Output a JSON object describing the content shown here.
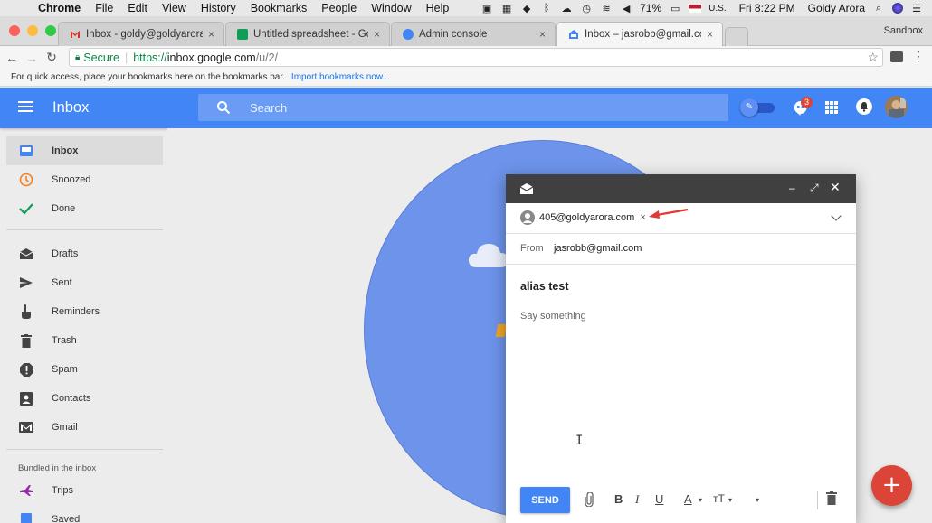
{
  "menubar": {
    "app": "Chrome",
    "menus": [
      "File",
      "Edit",
      "View",
      "History",
      "Bookmarks",
      "People",
      "Window",
      "Help"
    ],
    "battery": "71%",
    "input_source": "U.S.",
    "clock": "Fri 8:22 PM",
    "user": "Goldy Arora"
  },
  "tabs": [
    {
      "title": "Inbox - goldy@goldyarora.com",
      "favicon": "gmail-icon",
      "color": "#d93025"
    },
    {
      "title": "Untitled spreadsheet - Google",
      "favicon": "sheets-icon",
      "color": "#0f9d58"
    },
    {
      "title": "Admin console",
      "favicon": "admin-icon",
      "color": "#4285f4"
    },
    {
      "title": "Inbox – jasrobb@gmail.com",
      "favicon": "inbox-icon",
      "color": "#4285f4"
    }
  ],
  "window_profile": "Sandbox",
  "address": {
    "secure_label": "Secure",
    "scheme": "https://",
    "host": "inbox.google.com",
    "path": "/u/2/"
  },
  "bookmarks_bar": {
    "text": "For quick access, place your bookmarks here on the bookmarks bar.",
    "link": "Import bookmarks now..."
  },
  "header": {
    "title": "Inbox",
    "search_placeholder": "Search",
    "notification_count": "3"
  },
  "sidebar": {
    "items": [
      {
        "label": "Inbox",
        "icon": "inbox-icon"
      },
      {
        "label": "Snoozed",
        "icon": "clock-icon"
      },
      {
        "label": "Done",
        "icon": "check-icon"
      },
      {
        "label": "Drafts",
        "icon": "drafts-icon"
      },
      {
        "label": "Sent",
        "icon": "send-icon"
      },
      {
        "label": "Reminders",
        "icon": "reminder-hand-icon"
      },
      {
        "label": "Trash",
        "icon": "trash-icon"
      },
      {
        "label": "Spam",
        "icon": "spam-icon"
      },
      {
        "label": "Contacts",
        "icon": "contacts-icon"
      },
      {
        "label": "Gmail",
        "icon": "gmail-icon"
      }
    ],
    "bundled_label": "Bundled in the inbox",
    "bundles": [
      {
        "label": "Trips",
        "icon": "plane-icon"
      },
      {
        "label": "Saved",
        "icon": "saved-icon"
      }
    ]
  },
  "compose": {
    "recipient": "405@goldyarora.com",
    "from_label": "From",
    "from_value": "jasrobb@gmail.com",
    "subject": "alias test",
    "body_placeholder": "Say something",
    "send_label": "SEND"
  },
  "colors": {
    "accent": "#4285f4",
    "fab": "#db4437",
    "annotation_arrow": "#e53935"
  }
}
